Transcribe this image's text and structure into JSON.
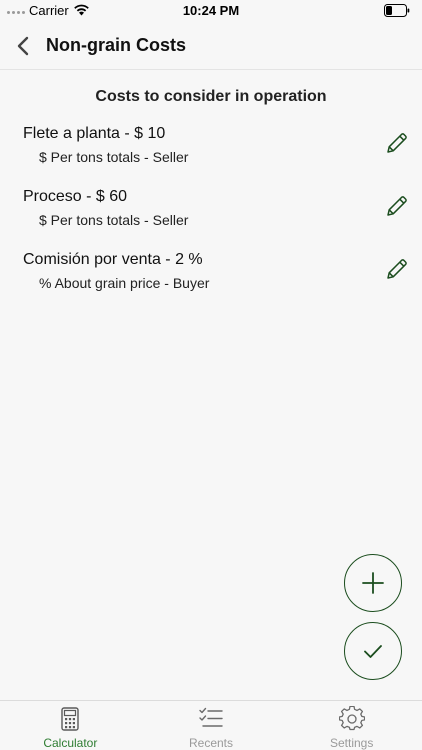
{
  "status": {
    "carrier": "Carrier",
    "time": "10:24 PM"
  },
  "nav": {
    "title": "Non-grain Costs"
  },
  "section": {
    "header": "Costs to consider in operation"
  },
  "costs": [
    {
      "label": "Flete a planta - $ 10",
      "detail": "$ Per tons totals - Seller"
    },
    {
      "label": "Proceso - $ 60",
      "detail": "$ Per tons totals - Seller"
    },
    {
      "label": "Comisión por venta - 2 %",
      "detail": "% About grain price - Buyer"
    }
  ],
  "tabs": [
    {
      "label": "Calculator",
      "icon": "calculator-icon",
      "active": true
    },
    {
      "label": "Recents",
      "icon": "checklist-icon",
      "active": false
    },
    {
      "label": "Settings",
      "icon": "gear-icon",
      "active": false
    }
  ],
  "colors": {
    "accent": "#1b4d1e",
    "active_tab": "#2e7d32",
    "inactive_tab": "#9a9a9a",
    "background": "#f7f7f7"
  }
}
